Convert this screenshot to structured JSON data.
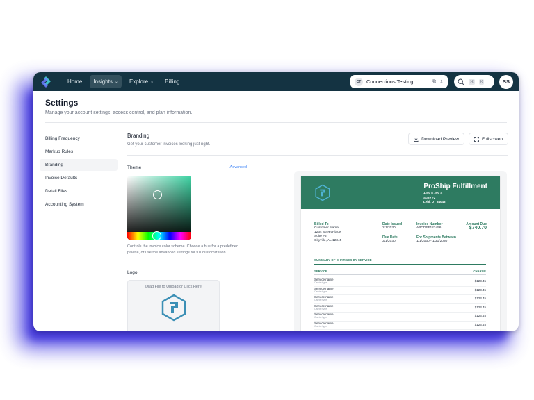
{
  "nav": {
    "items": [
      {
        "label": "Home",
        "active": false,
        "dropdown": false
      },
      {
        "label": "Insights",
        "active": true,
        "dropdown": true
      },
      {
        "label": "Explore",
        "active": false,
        "dropdown": true
      },
      {
        "label": "Billing",
        "active": false,
        "dropdown": false
      }
    ],
    "org_badge": "CT",
    "org_name": "Connections Testing",
    "search_kbd": [
      "⌘",
      "K"
    ],
    "avatar": "SS"
  },
  "page": {
    "title": "Settings",
    "subtitle": "Manage your account settings, access control, and plan information."
  },
  "sidebar": {
    "items": [
      {
        "label": "Billing Frequency",
        "active": false
      },
      {
        "label": "Markup Rules",
        "active": false
      },
      {
        "label": "Branding",
        "active": true
      },
      {
        "label": "Invoice Defaults",
        "active": false
      },
      {
        "label": "Detail Files",
        "active": false
      },
      {
        "label": "Accounting System",
        "active": false
      }
    ]
  },
  "branding": {
    "title": "Branding",
    "subtitle": "Get your customer invoices looking just right.",
    "download_label": "Download Preview",
    "fullscreen_label": "Fullscreen",
    "theme_label": "Theme",
    "advanced_label": "Advanced",
    "picker_help": "Controls the invoice color scheme. Choose a hue for a predefined palette, or use the advanced settings for full customization.",
    "logo_label": "Logo",
    "upload_text": "Drag File to Upload or Click Here",
    "theme_color": "#2e7b61"
  },
  "invoice": {
    "company": "ProShip Fulfillment",
    "company_address": [
      "1250 E 200 S",
      "Suite #2",
      "Lehi, UT 84043"
    ],
    "billed_to_label": "Billed To",
    "billed_to": [
      "Customer Name",
      "1234 Street Place",
      "Suite #5",
      "Cityville, AL 12345"
    ],
    "date_issued_label": "Date Issued",
    "date_issued": "2/1/2030",
    "due_date_label": "Due Date",
    "due_date": "3/1/2030",
    "invoice_number_label": "Invoice Number",
    "invoice_number": "ABCDEF123456",
    "shipments_label": "For Shipments Between",
    "shipments_range": "1/1/2030 - 1/31/2030",
    "amount_due_label": "Amount Due",
    "amount_due": "$740.70",
    "summary_label": "SUMMARY OF CHARGES BY SERVICE",
    "col_service": "SERVICE",
    "col_charge": "CHARGE",
    "rows": [
      {
        "name": "Service name",
        "sub": "Carrier/type",
        "amount": "$123.45"
      },
      {
        "name": "Service name",
        "sub": "Carrier/type",
        "amount": "$123.45"
      },
      {
        "name": "Service name",
        "sub": "Carrier/type",
        "amount": "$123.45"
      },
      {
        "name": "Service name",
        "sub": "Carrier/type",
        "amount": "$123.45"
      },
      {
        "name": "Service name",
        "sub": "Carrier/type",
        "amount": "$123.45"
      },
      {
        "name": "Service name",
        "sub": "Carrier/type",
        "amount": "$123.45"
      }
    ]
  }
}
